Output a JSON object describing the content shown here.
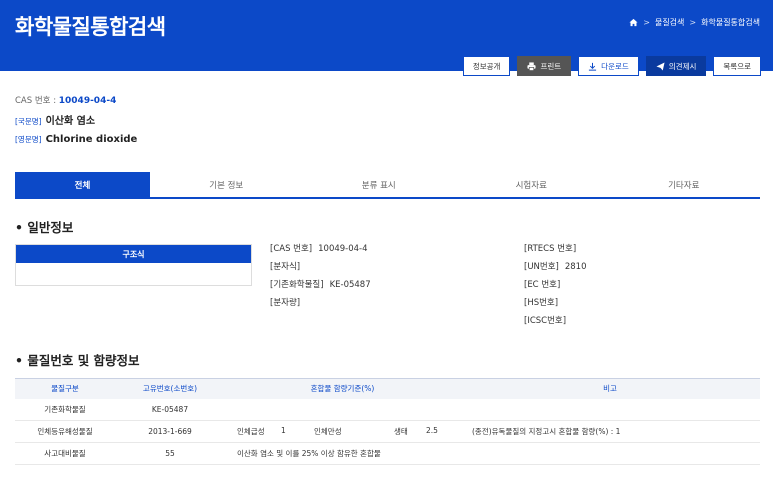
{
  "header": {
    "title": "화학물질통합검색",
    "breadcrumb": [
      "물질검색",
      "화학물질통합검색"
    ],
    "bg_color": "#0c49c8"
  },
  "toolbar": {
    "info": "정보공개",
    "print": "프린트",
    "download": "다운로드",
    "opinion": "의견제시",
    "list": "목록으로"
  },
  "substance": {
    "cas_label": "CAS 번호 : ",
    "cas_value": "10049-04-4",
    "kor_tag": "[국문명]",
    "kor_name": "이산화 염소",
    "eng_tag": "[영문명]",
    "eng_name": "Chlorine dioxide"
  },
  "tabs": [
    "전체",
    "기본 정보",
    "분류 표시",
    "시험자료",
    "기타자료"
  ],
  "general": {
    "title": "일반정보",
    "structure_label": "구조식",
    "left_fields": [
      {
        "label": "[CAS 번호]",
        "value": "10049-04-4"
      },
      {
        "label": "[분자식]",
        "value": ""
      },
      {
        "label": "[기존화학물질]",
        "value": "KE-05487"
      },
      {
        "label": "[분자량]",
        "value": ""
      }
    ],
    "right_fields": [
      {
        "label": "[RTECS 번호]",
        "value": ""
      },
      {
        "label": "[UN번호]",
        "value": "2810"
      },
      {
        "label": "[EC 번호]",
        "value": ""
      },
      {
        "label": "[HS번호]",
        "value": ""
      },
      {
        "label": "[ICSC번호]",
        "value": ""
      }
    ]
  },
  "materials": {
    "title": "물질번호 및 함량정보",
    "headers": [
      "물질구분",
      "고유번호(소번호)",
      "혼합물 함량기준(%)",
      "비고"
    ],
    "rows": [
      {
        "type": "기존화학물질",
        "id": "KE-05487",
        "mix": [],
        "note": ""
      },
      {
        "type": "인체등유해성물질",
        "id": "2013-1-669",
        "mix": [
          "인체급성",
          "1",
          "인체만성",
          "생태",
          "2.5"
        ],
        "note": "(종전)유독물질의 지정고시 혼합물 함량(%) : 1"
      },
      {
        "type": "사고대비물질",
        "id": "55",
        "mix": [
          "이산화 염소 및 이를 25% 이상 함유한 혼합물"
        ],
        "note": ""
      }
    ]
  }
}
